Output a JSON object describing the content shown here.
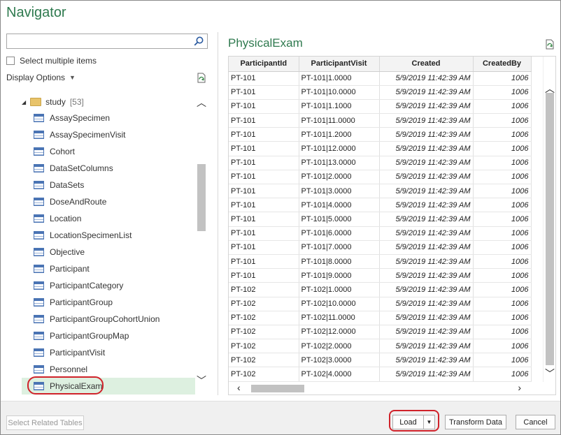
{
  "window": {
    "title": "Navigator"
  },
  "left": {
    "search": {
      "value": "",
      "placeholder": ""
    },
    "select_multiple_label": "Select multiple items",
    "display_options_label": "Display Options",
    "folder": {
      "name": "study",
      "count": "[53]"
    },
    "items": [
      "AssaySpecimen",
      "AssaySpecimenVisit",
      "Cohort",
      "DataSetColumns",
      "DataSets",
      "DoseAndRoute",
      "Location",
      "LocationSpecimenList",
      "Objective",
      "Participant",
      "ParticipantCategory",
      "ParticipantGroup",
      "ParticipantGroupCohortUnion",
      "ParticipantGroupMap",
      "ParticipantVisit",
      "Personnel",
      "PhysicalExam"
    ],
    "selected_item": "PhysicalExam"
  },
  "preview": {
    "title": "PhysicalExam",
    "columns": [
      "ParticipantId",
      "ParticipantVisit",
      "Created",
      "CreatedBy"
    ],
    "rows": [
      [
        "PT-101",
        "PT-101|1.0000",
        "5/9/2019 11:42:39 AM",
        "1006"
      ],
      [
        "PT-101",
        "PT-101|10.0000",
        "5/9/2019 11:42:39 AM",
        "1006"
      ],
      [
        "PT-101",
        "PT-101|1.1000",
        "5/9/2019 11:42:39 AM",
        "1006"
      ],
      [
        "PT-101",
        "PT-101|11.0000",
        "5/9/2019 11:42:39 AM",
        "1006"
      ],
      [
        "PT-101",
        "PT-101|1.2000",
        "5/9/2019 11:42:39 AM",
        "1006"
      ],
      [
        "PT-101",
        "PT-101|12.0000",
        "5/9/2019 11:42:39 AM",
        "1006"
      ],
      [
        "PT-101",
        "PT-101|13.0000",
        "5/9/2019 11:42:39 AM",
        "1006"
      ],
      [
        "PT-101",
        "PT-101|2.0000",
        "5/9/2019 11:42:39 AM",
        "1006"
      ],
      [
        "PT-101",
        "PT-101|3.0000",
        "5/9/2019 11:42:39 AM",
        "1006"
      ],
      [
        "PT-101",
        "PT-101|4.0000",
        "5/9/2019 11:42:39 AM",
        "1006"
      ],
      [
        "PT-101",
        "PT-101|5.0000",
        "5/9/2019 11:42:39 AM",
        "1006"
      ],
      [
        "PT-101",
        "PT-101|6.0000",
        "5/9/2019 11:42:39 AM",
        "1006"
      ],
      [
        "PT-101",
        "PT-101|7.0000",
        "5/9/2019 11:42:39 AM",
        "1006"
      ],
      [
        "PT-101",
        "PT-101|8.0000",
        "5/9/2019 11:42:39 AM",
        "1006"
      ],
      [
        "PT-101",
        "PT-101|9.0000",
        "5/9/2019 11:42:39 AM",
        "1006"
      ],
      [
        "PT-102",
        "PT-102|1.0000",
        "5/9/2019 11:42:39 AM",
        "1006"
      ],
      [
        "PT-102",
        "PT-102|10.0000",
        "5/9/2019 11:42:39 AM",
        "1006"
      ],
      [
        "PT-102",
        "PT-102|11.0000",
        "5/9/2019 11:42:39 AM",
        "1006"
      ],
      [
        "PT-102",
        "PT-102|12.0000",
        "5/9/2019 11:42:39 AM",
        "1006"
      ],
      [
        "PT-102",
        "PT-102|2.0000",
        "5/9/2019 11:42:39 AM",
        "1006"
      ],
      [
        "PT-102",
        "PT-102|3.0000",
        "5/9/2019 11:42:39 AM",
        "1006"
      ],
      [
        "PT-102",
        "PT-102|4.0000",
        "5/9/2019 11:42:39 AM",
        "1006"
      ]
    ]
  },
  "footer": {
    "related_label": "Select Related Tables",
    "load_label": "Load",
    "transform_label": "Transform Data",
    "cancel_label": "Cancel"
  },
  "colors": {
    "accent": "#2f7a4f",
    "selection": "#ddf0e0",
    "highlight_ring": "#d0222a"
  }
}
